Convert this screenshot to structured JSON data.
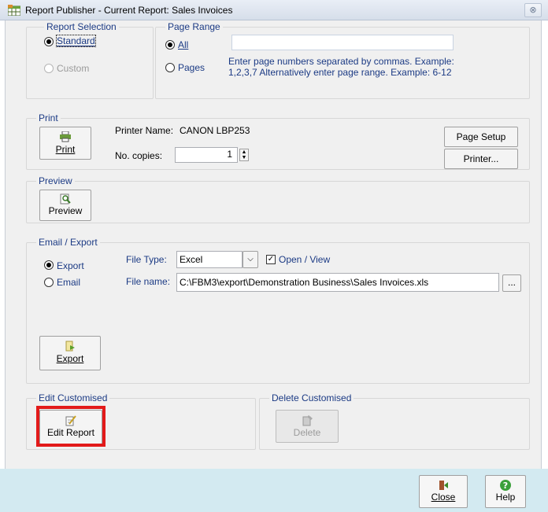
{
  "window": {
    "title": "Report Publisher - Current Report: Sales Invoices",
    "close_glyph": "⊗"
  },
  "report_selection": {
    "legend": "Report Selection",
    "standard_label": "Standard",
    "custom_label": "Custom",
    "selected": "Standard"
  },
  "page_range": {
    "legend": "Page Range",
    "all_label": "All",
    "pages_label": "Pages",
    "pages_value": "",
    "hint_line1": "Enter page numbers separated by commas. Example:",
    "hint_line2": "1,2,3,7 Alternatively enter page range. Example: 6-12",
    "selected": "All"
  },
  "print": {
    "legend": "Print",
    "print_button": "Print",
    "printer_name_label": "Printer Name:",
    "printer_name": "CANON LBP253",
    "copies_label": "No. copies:",
    "copies_value": "1",
    "page_setup_button": "Page Setup",
    "printer_button": "Printer..."
  },
  "preview": {
    "legend": "Preview",
    "preview_button": "Preview"
  },
  "email_export": {
    "legend": "Email / Export",
    "export_radio": "Export",
    "email_radio": "Email",
    "selected": "Export",
    "file_type_label": "File Type:",
    "file_type_value": "Excel",
    "open_view_label": "Open / View",
    "open_view_checked": true,
    "file_name_label": "File name:",
    "file_name_value": "C:\\FBM3\\export\\Demonstration Business\\Sales Invoices.xls",
    "browse_button": "...",
    "export_button": "Export"
  },
  "edit_customised": {
    "legend": "Edit Customised",
    "edit_report_button": "Edit Report"
  },
  "delete_customised": {
    "legend": "Delete Customised",
    "delete_button": "Delete"
  },
  "footer": {
    "close_button": "Close",
    "help_button": "Help"
  },
  "colors": {
    "label_blue": "#1b3a84",
    "highlight_red": "#e21a1a",
    "footer_strip": "#d3eaf1"
  }
}
